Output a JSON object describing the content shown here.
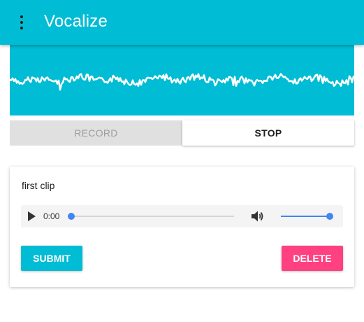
{
  "app": {
    "title": "Vocalize",
    "menu_icon": "more-vert-icon"
  },
  "colors": {
    "primary": "#00bcd4",
    "accent": "#ff4081",
    "slider": "#4285f4",
    "disabled_bg": "#e0e0e0",
    "disabled_text": "#9e9e9e"
  },
  "controls": {
    "record_label": "RECORD",
    "stop_label": "STOP",
    "record_enabled": false
  },
  "clips": [
    {
      "name": "first clip",
      "player": {
        "time": "0:00",
        "progress": 0,
        "volume": 1.0,
        "play_icon": "play-icon",
        "volume_icon": "volume-up-icon"
      },
      "submit_label": "SUBMIT",
      "delete_label": "DELETE"
    }
  ]
}
